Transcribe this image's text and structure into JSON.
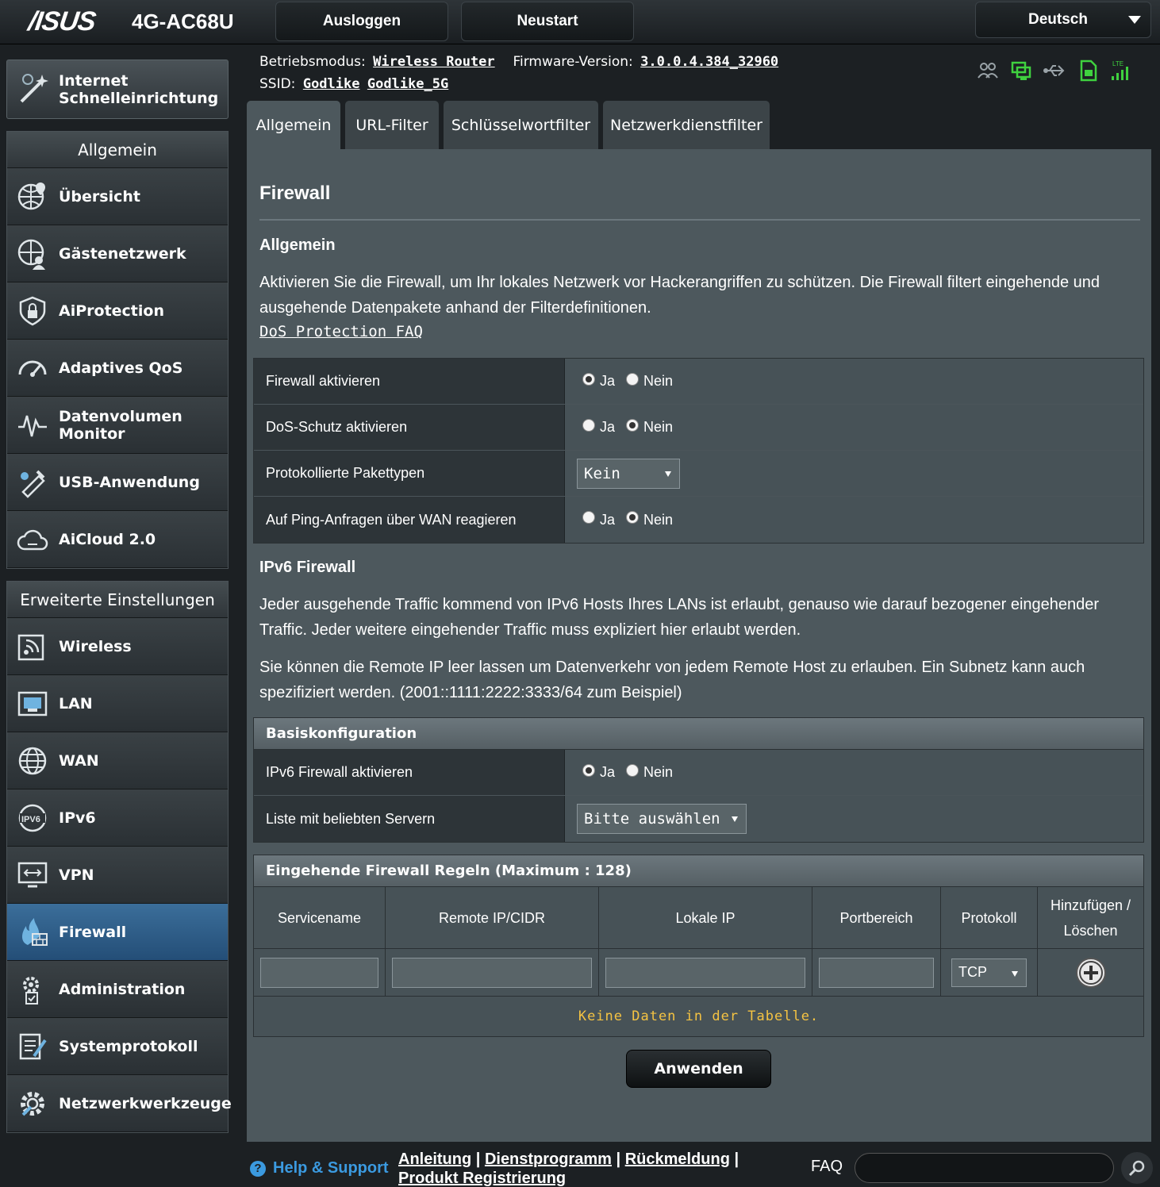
{
  "header": {
    "brand": "/ISUS",
    "model": "4G-AC68U",
    "logout_label": "Ausloggen",
    "reboot_label": "Neustart",
    "language": "Deutsch"
  },
  "info": {
    "mode_label": "Betriebsmodus:",
    "mode_value": "Wireless Router",
    "firmware_label": "Firmware-Version:",
    "firmware_value": "3.0.0.4.384_32960",
    "ssid_label": "SSID:",
    "ssid_1": "Godlike",
    "ssid_2": "Godlike_5G"
  },
  "status_icons": [
    "clients-icon",
    "network-icon",
    "usb-icon",
    "sim-icon",
    "lte-signal-icon"
  ],
  "sidebar": {
    "quick_setup": [
      "Internet",
      "Schnelleinrichtung"
    ],
    "general_title": "Allgemein",
    "general_items": [
      {
        "label": "Übersicht",
        "icon": "globe-map-icon"
      },
      {
        "label": "Gästenetzwerk",
        "icon": "guest-network-icon"
      },
      {
        "label": "AiProtection",
        "icon": "shield-lock-icon"
      },
      {
        "label": "Adaptives QoS",
        "icon": "gauge-icon"
      },
      {
        "label": "Datenvolumen",
        "label2": "Monitor",
        "icon": "traffic-monitor-icon"
      },
      {
        "label": "USB-Anwendung",
        "icon": "usb-app-icon"
      },
      {
        "label": "AiCloud 2.0",
        "icon": "cloud-icon"
      }
    ],
    "advanced_title": "Erweiterte Einstellungen",
    "advanced_items": [
      {
        "label": "Wireless",
        "icon": "wireless-icon"
      },
      {
        "label": "LAN",
        "icon": "lan-icon"
      },
      {
        "label": "WAN",
        "icon": "wan-globe-icon"
      },
      {
        "label": "IPv6",
        "icon": "ipv6-icon"
      },
      {
        "label": "VPN",
        "icon": "vpn-icon"
      },
      {
        "label": "Firewall",
        "icon": "firewall-icon",
        "active": true
      },
      {
        "label": "Administration",
        "icon": "admin-gear-icon"
      },
      {
        "label": "Systemprotokoll",
        "icon": "system-log-icon"
      },
      {
        "label": "Netzwerkwerkzeuge",
        "icon": "network-tools-icon"
      }
    ]
  },
  "tabs": [
    "Allgemein",
    "URL-Filter",
    "Schlüsselwortfilter",
    "Netzwerkdienstfilter"
  ],
  "main": {
    "title": "Firewall",
    "general_heading": "Allgemein",
    "general_text": "Aktivieren Sie die Firewall, um Ihr lokales Netzwerk vor Hackerangriffen zu schützen. Die Firewall filtert eingehende und ausgehende Datenpakete anhand der Filterdefinitionen.",
    "faq_link": "DoS Protection FAQ",
    "yes": "Ja",
    "no": "Nein",
    "settings": [
      {
        "label": "Firewall aktivieren",
        "value": "Ja"
      },
      {
        "label": "DoS-Schutz aktivieren",
        "value": "Nein"
      },
      {
        "label": "Protokollierte Pakettypen",
        "select": "Kein"
      },
      {
        "label": "Auf Ping-Anfragen über WAN reagieren",
        "value": "Nein"
      }
    ],
    "ipv6_heading": "IPv6 Firewall",
    "ipv6_text1": "Jeder ausgehende Traffic kommend von IPv6 Hosts Ihres LANs ist erlaubt, genauso wie darauf bezogener eingehender Traffic. Jeder weitere eingehender Traffic muss expliziert hier erlaubt werden.",
    "ipv6_text2": "Sie können die Remote IP leer lassen um Datenverkehr von jedem Remote Host zu erlauben. Ein Subnetz kann auch spezifiziert werden. (2001::1111:2222:3333/64 zum Beispiel)",
    "basic_config": {
      "title": "Basiskonfiguration",
      "ipv6_fw_label": "IPv6 Firewall aktivieren",
      "ipv6_fw_value": "Ja",
      "servers_label": "Liste mit beliebten Servern",
      "servers_select": "Bitte auswählen"
    },
    "rules": {
      "title": "Eingehende Firewall Regeln (Maximum : 128)",
      "columns": [
        "Servicename",
        "Remote IP/CIDR",
        "Lokale IP",
        "Portbereich",
        "Protokoll",
        "Hinzufügen /",
        "Löschen"
      ],
      "protocol_value": "TCP",
      "empty_text": "Keine Daten in der Tabelle."
    },
    "apply_label": "Anwenden"
  },
  "footer": {
    "help": "Help & Support",
    "links": [
      "Anleitung",
      "Dienstprogramm",
      "Rückmeldung",
      "Produkt Registrierung"
    ],
    "faq": "FAQ"
  }
}
